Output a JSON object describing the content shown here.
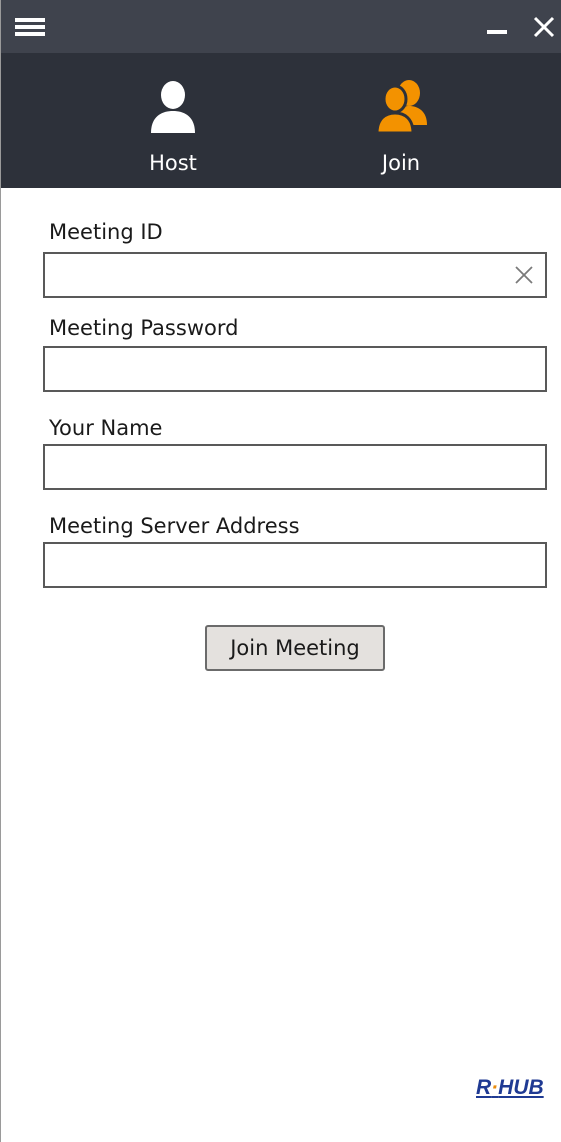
{
  "titlebar": {
    "menu_icon": "hamburger-menu-icon",
    "minimize_icon": "minimize-icon",
    "close_icon": "close-icon"
  },
  "nav": {
    "tabs": [
      {
        "label": "Host",
        "icon": "person-icon",
        "color": "#ffffff",
        "active": false
      },
      {
        "label": "Join",
        "icon": "people-icon",
        "color": "#f39200",
        "active": true
      }
    ]
  },
  "form": {
    "meeting_id": {
      "label": "Meeting ID",
      "value": "",
      "clear_icon": "clear-x-icon"
    },
    "meeting_password": {
      "label": "Meeting Password",
      "value": ""
    },
    "your_name": {
      "label": "Your Name",
      "value": ""
    },
    "server_address": {
      "label": "Meeting Server Address",
      "value": ""
    },
    "join_button": "Join Meeting"
  },
  "footer": {
    "logo_left": "R",
    "logo_dot": "·",
    "logo_right": "HUB"
  },
  "colors": {
    "titlebar_bg": "#3f434d",
    "nav_bg": "#2d313a",
    "accent": "#f39200",
    "logo_blue": "#1f3a93"
  }
}
